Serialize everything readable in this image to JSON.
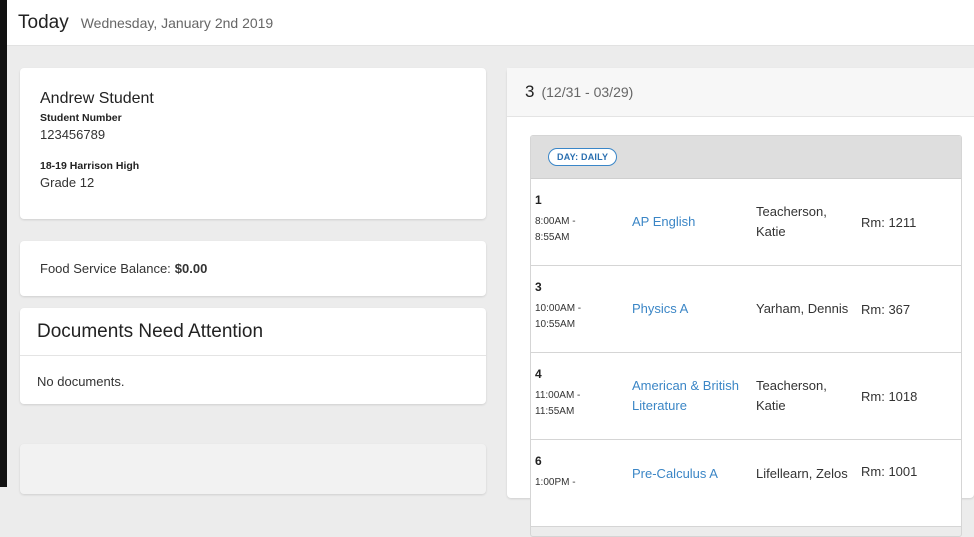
{
  "header": {
    "title": "Today",
    "date": "Wednesday, January 2nd 2019"
  },
  "student": {
    "name": "Andrew Student",
    "number_label": "Student Number",
    "number": "123456789",
    "school": "18-19 Harrison High",
    "grade": "Grade 12"
  },
  "food": {
    "label": "Food Service Balance:",
    "balance": "$0.00"
  },
  "documents": {
    "title": "Documents Need Attention",
    "empty": "No documents."
  },
  "schedule": {
    "term": "3",
    "range": "(12/31 - 03/29)",
    "day_label": "DAY: DAILY",
    "periods": [
      {
        "period": "1",
        "start": "8:00AM -",
        "end": "8:55AM",
        "course": "AP English",
        "teacher": "Teacherson, Katie",
        "room": "Rm: 1211"
      },
      {
        "period": "3",
        "start": "10:00AM -",
        "end": "10:55AM",
        "course": "Physics A",
        "teacher": "Yarham, Dennis",
        "room": "Rm: 367"
      },
      {
        "period": "4",
        "start": "11:00AM -",
        "end": "11:55AM",
        "course": "American & British Literature",
        "teacher": "Teacherson, Katie",
        "room": "Rm: 1018"
      },
      {
        "period": "6",
        "start": "1:00PM -",
        "end": "",
        "course": "Pre-Calculus A",
        "teacher": "Lifellearn, Zelos",
        "room": "Rm: 1001"
      }
    ]
  },
  "colors": {
    "link": "#3b86c6",
    "pill_border": "#3a86c8",
    "left_bar": "#111111"
  }
}
